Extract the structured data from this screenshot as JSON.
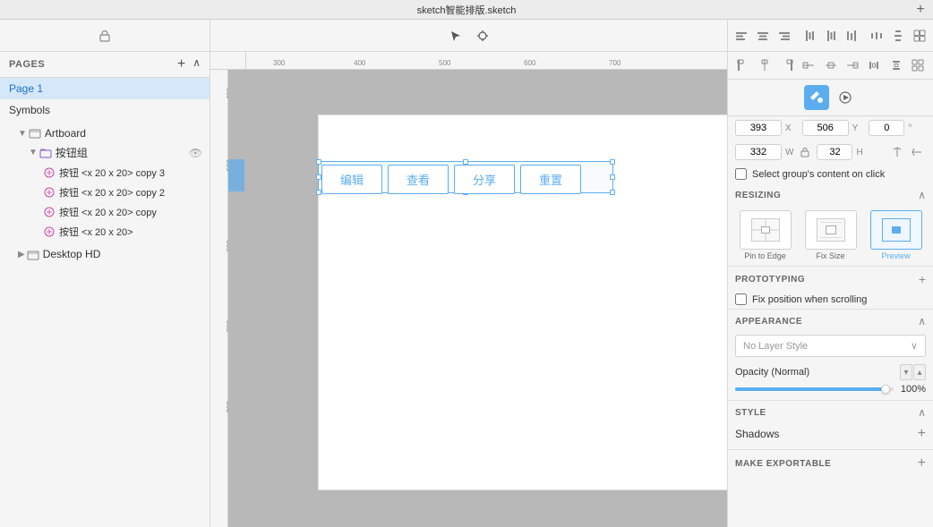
{
  "window": {
    "title": "sketch智能排版.sketch",
    "plus_btn": "+"
  },
  "left_panel": {
    "pages_label": "PAGES",
    "add_page": "+",
    "collapse": "∧",
    "pages": [
      {
        "name": "Page 1",
        "active": true
      },
      {
        "name": "Symbols",
        "active": false
      }
    ],
    "layers": [
      {
        "id": "artboard",
        "label": "Artboard",
        "indent": 1,
        "type": "group",
        "expanded": true
      },
      {
        "id": "btn-group",
        "label": "按钮组",
        "indent": 2,
        "type": "folder",
        "expanded": true
      },
      {
        "id": "btn-copy3",
        "label": "按钮 <x 20 x 20>  copy 3",
        "indent": 3,
        "type": "symbol"
      },
      {
        "id": "btn-copy2",
        "label": "按钮 <x 20 x 20>  copy 2",
        "indent": 3,
        "type": "symbol"
      },
      {
        "id": "btn-copy",
        "label": "按钮 <x 20 x 20>  copy",
        "indent": 3,
        "type": "symbol"
      },
      {
        "id": "btn",
        "label": "按钮 <x 20 x 20>",
        "indent": 3,
        "type": "symbol"
      }
    ],
    "desktop_hd": "Desktop HD"
  },
  "canvas": {
    "ruler_h_marks": [
      "300",
      "400",
      "500",
      "600",
      "700"
    ],
    "ruler_v_marks": [
      "400",
      "500",
      "600",
      "700",
      "800"
    ],
    "buttons": [
      {
        "label": "编辑"
      },
      {
        "label": "查看"
      },
      {
        "label": "分享"
      },
      {
        "label": "重置"
      }
    ]
  },
  "right_panel": {
    "toolbar_buttons": [
      "⬜",
      "⬜",
      "⬜",
      "⬜",
      "⬜",
      "⬜",
      "⬜",
      "⬜",
      "⬜"
    ],
    "style_tabs": [
      {
        "icon": "♦",
        "label": "fill-tab",
        "active": true
      },
      {
        "icon": "◷",
        "label": "prototype-tab",
        "active": false
      }
    ],
    "position": {
      "x_label": "X",
      "x_value": "393",
      "y_label": "Y",
      "y_value": "506",
      "r_label": "°",
      "r_value": "0"
    },
    "size": {
      "w_label": "W",
      "w_value": "332",
      "h_label": "H",
      "h_value": "32"
    },
    "select_group_label": "Select group's content on click",
    "resizing": {
      "title": "RESIZING",
      "options": [
        {
          "label": "Pin to Edge",
          "selected": false
        },
        {
          "label": "Fix Size",
          "selected": false
        },
        {
          "label": "Preview",
          "selected": true
        }
      ]
    },
    "prototyping": {
      "title": "PROTOTYPING",
      "fix_position_label": "Fix position when scrolling"
    },
    "appearance": {
      "title": "APPEARANCE",
      "layer_style_placeholder": "No Layer Style",
      "opacity_label": "Opacity (Normal)",
      "opacity_value": "100%",
      "opacity_percent": 100
    },
    "style": {
      "title": "STYLE",
      "shadows_label": "Shadows",
      "add_shadow": "+"
    },
    "export": {
      "title": "MAKE EXPORTABLE",
      "add": "+"
    }
  }
}
